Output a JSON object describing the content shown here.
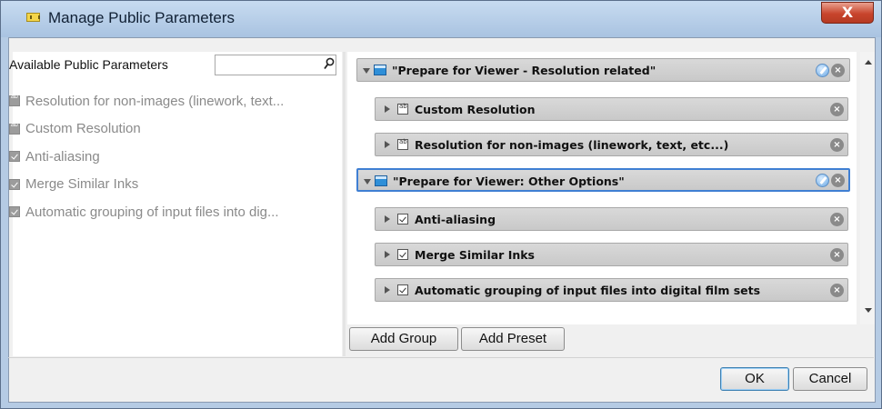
{
  "window": {
    "title": "Manage Public Parameters",
    "close_label": "X"
  },
  "left_panel": {
    "label": "Available Public Parameters",
    "search": {
      "value": "",
      "placeholder": ""
    },
    "items": [
      {
        "label": "Resolution for non-images (linework, text...",
        "icon": "text-field-icon"
      },
      {
        "label": "Custom Resolution",
        "icon": "text-field-icon"
      },
      {
        "label": "Anti-aliasing",
        "icon": "checkbox-icon"
      },
      {
        "label": "Merge Similar Inks",
        "icon": "checkbox-icon"
      },
      {
        "label": "Automatic grouping of input files into dig...",
        "icon": "checkbox-icon"
      }
    ]
  },
  "right_panel": {
    "groups": [
      {
        "label": "\"Prepare for Viewer - Resolution related\"",
        "expanded": true,
        "selected": false,
        "params": [
          {
            "label": "Custom Resolution",
            "icon": "text-field-icon"
          },
          {
            "label": "Resolution for non-images (linework, text, etc...)",
            "icon": "text-field-icon"
          }
        ]
      },
      {
        "label": "\"Prepare for Viewer: Other Options\"",
        "expanded": true,
        "selected": true,
        "params": [
          {
            "label": "Anti-aliasing",
            "icon": "checkbox-icon"
          },
          {
            "label": "Merge Similar Inks",
            "icon": "checkbox-icon"
          },
          {
            "label": "Automatic grouping of input files into digital film sets",
            "icon": "checkbox-icon"
          }
        ]
      }
    ]
  },
  "buttons": {
    "add_group": "Add Group",
    "add_preset": "Add Preset",
    "ok": "OK",
    "cancel": "Cancel"
  },
  "colors": {
    "selection_border": "#3f7fd3",
    "close_button": "#c8452d",
    "group_icon": "#2f8fd8"
  }
}
